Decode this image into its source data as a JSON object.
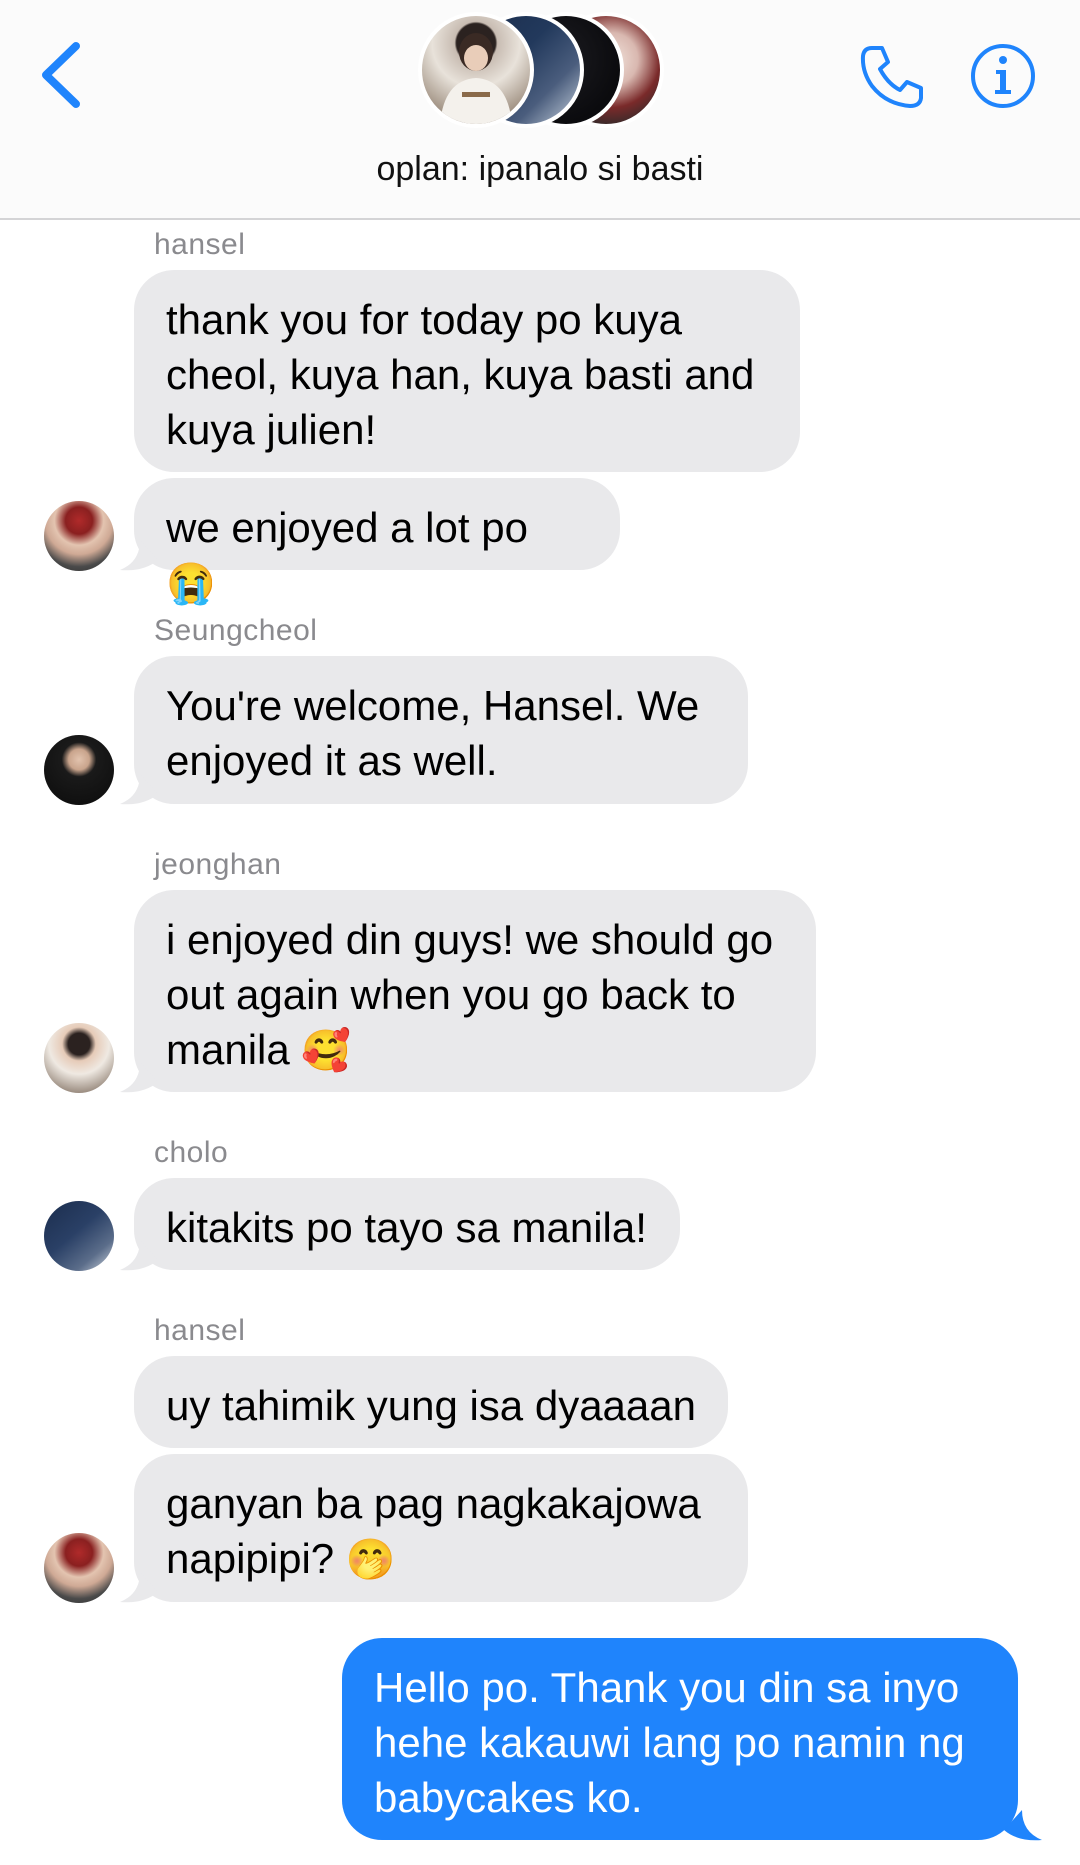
{
  "header": {
    "group_name": "oplan: ipanalo si basti",
    "colors": {
      "accent": "#1f84fc",
      "bubble_in": "#e9e9eb",
      "bubble_out": "#1f84fc"
    }
  },
  "messages": [
    {
      "sender": "hansel",
      "texts": [
        "thank you for today po kuya cheol, kuya han, kuya basti and kuya julien!",
        "we enjoyed a lot po",
        "😭"
      ]
    },
    {
      "sender": "Seungcheol",
      "texts": [
        "You're welcome, Hansel. We enjoyed it as well."
      ]
    },
    {
      "sender": "jeonghan",
      "texts": [
        "i enjoyed din guys! we should go out again when you go back to manila",
        "🥰"
      ]
    },
    {
      "sender": "cholo",
      "texts": [
        "kitakits po tayo sa manila!"
      ]
    },
    {
      "sender": "hansel",
      "texts": [
        "uy tahimik yung isa dyaaaan",
        "ganyan ba pag nagkakajowa napipipi?",
        "🤭"
      ]
    },
    {
      "sender": "me",
      "texts": [
        "Hello po. Thank you din sa inyo hehe kakauwi lang po namin ng babycakes ko."
      ]
    }
  ],
  "icons": {
    "back": "chevron-left-icon",
    "call": "phone-icon",
    "info": "info-icon"
  }
}
